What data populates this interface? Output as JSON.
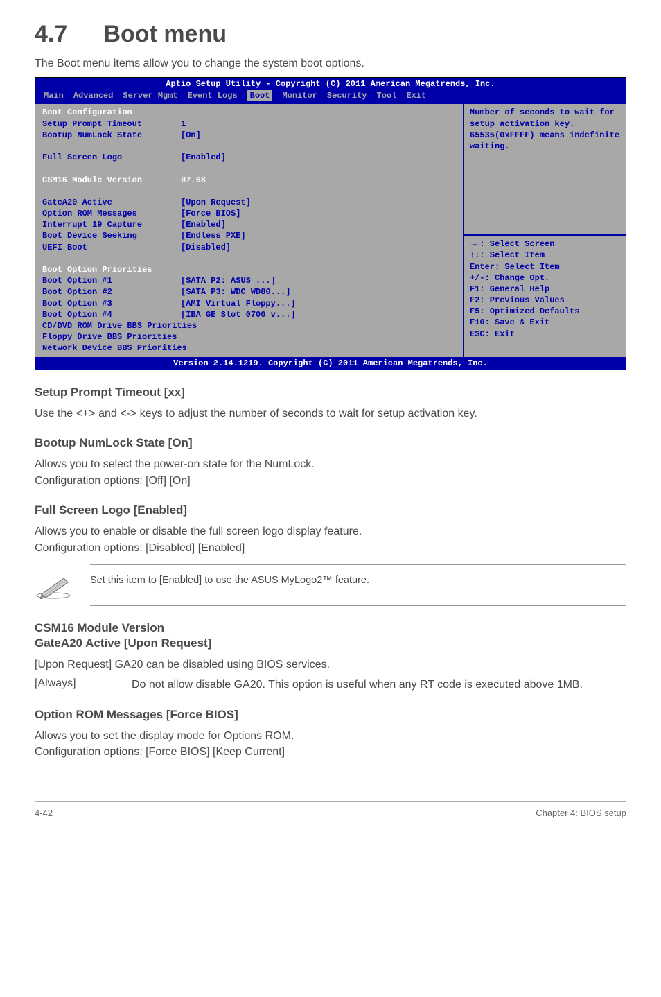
{
  "section": {
    "number": "4.7",
    "title": "Boot menu",
    "intro": "The Boot menu items allow you to change the system boot options."
  },
  "bios": {
    "header": "Aptio Setup Utility - Copyright (C) 2011 American Megatrends, Inc.",
    "tabs": [
      "Main",
      "Advanced",
      "Server Mgmt",
      "Event Logs",
      "Boot",
      "Monitor",
      "Security",
      "Tool",
      "Exit"
    ],
    "active_tab": "Boot",
    "config_title": "Boot Configuration",
    "rows": [
      {
        "label": "Setup Prompt Timeout",
        "value": "1",
        "type": "blue"
      },
      {
        "label": "Bootup NumLock State",
        "value": "[On]",
        "type": "blue"
      },
      {
        "label": "",
        "value": "",
        "type": "spacer"
      },
      {
        "label": "Full Screen Logo",
        "value": "[Enabled]",
        "type": "blue"
      },
      {
        "label": "",
        "value": "",
        "type": "spacer"
      },
      {
        "label": "CSM16 Module Version",
        "value": " 07.68",
        "type": "white"
      },
      {
        "label": "",
        "value": "",
        "type": "spacer"
      },
      {
        "label": "GateA20 Active",
        "value": "[Upon Request]",
        "type": "blue"
      },
      {
        "label": "Option ROM Messages",
        "value": "[Force BIOS]",
        "type": "blue"
      },
      {
        "label": "Interrupt 19 Capture",
        "value": "[Enabled]",
        "type": "blue"
      },
      {
        "label": "Boot Device Seeking",
        "value": "[Endless PXE]",
        "type": "blue"
      },
      {
        "label": "UEFI Boot",
        "value": "[Disabled]",
        "type": "blue"
      }
    ],
    "priorities_title": "Boot Option Priorities",
    "priorities": [
      {
        "label": "Boot Option #1",
        "value": "[SATA  P2: ASUS   ...]"
      },
      {
        "label": "Boot Option #2",
        "value": "[SATA  P3: WDC WD80...]"
      },
      {
        "label": "Boot Option #3",
        "value": "[AMI Virtual Floppy...]"
      },
      {
        "label": "Boot Option #4",
        "value": "[IBA GE Slot 0700 v...]"
      }
    ],
    "bottom_items": [
      "CD/DVD ROM Drive BBS Priorities",
      "Floppy Drive BBS Priorities",
      "Network Device BBS Priorities"
    ],
    "help_text": "Number of seconds to wait for setup activation key. 65535(0xFFFF) means indefinite waiting.",
    "nav": [
      "→←: Select Screen",
      "↑↓:  Select Item",
      "Enter: Select Item",
      "+/-: Change Opt.",
      "F1: General Help",
      "F2: Previous Values",
      "F5: Optimized Defaults",
      "F10: Save & Exit",
      "ESC: Exit"
    ],
    "footer": "Version 2.14.1219. Copyright (C) 2011 American Megatrends, Inc."
  },
  "subsections": {
    "setup_prompt": {
      "title": "Setup Prompt Timeout [xx]",
      "text": "Use the <+> and <-> keys to adjust the number of seconds to wait for setup activation key."
    },
    "bootup_numlock": {
      "title": "Bootup NumLock State [On]",
      "text1": "Allows you to select the power-on state for the NumLock.",
      "text2": "Configuration options: [Off] [On]"
    },
    "full_screen": {
      "title": "Full Screen Logo [Enabled]",
      "text1": "Allows you to enable or disable the full screen logo display feature.",
      "text2": "Configuration options: [Disabled] [Enabled]"
    },
    "note": "Set this item to [Enabled] to use the ASUS MyLogo2™ feature.",
    "csm16": {
      "title1": "CSM16 Module Version",
      "title2": "GateA20 Active [Upon Request]",
      "text1": "[Upon Request] GA20 can be disabled using BIOS services.",
      "always_label": "[Always]",
      "always_text": "Do not allow disable GA20. This option is useful when any RT code is executed above 1MB."
    },
    "option_rom": {
      "title": "Option ROM Messages [Force BIOS]",
      "text1": "Allows you to set the display mode for Options ROM.",
      "text2": "Configuration options: [Force BIOS] [Keep Current]"
    }
  },
  "footer": {
    "left": "4-42",
    "right": "Chapter 4: BIOS setup"
  }
}
